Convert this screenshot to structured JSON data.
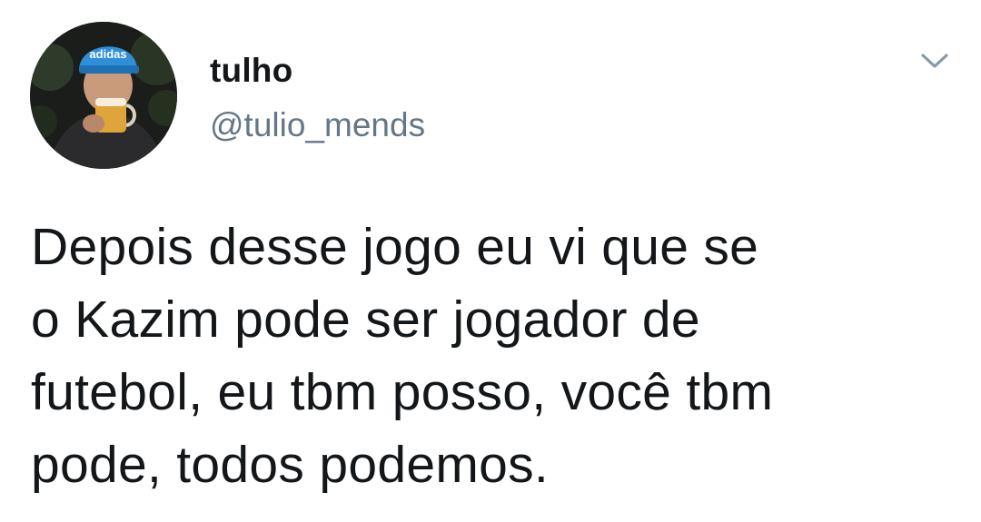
{
  "author": {
    "display_name": "tulho",
    "handle": "@tulio_mends",
    "avatar": {
      "icon": "profile-photo",
      "cap_text": "adidas"
    }
  },
  "menu": {
    "icon": "chevron-down-icon"
  },
  "tweet": {
    "lines": [
      "Depois desse jogo eu vi que se",
      "o Kazim pode ser jogador de",
      "futebol, eu tbm posso, você tbm",
      "pode, todos podemos."
    ]
  },
  "colors": {
    "text": "#14171a",
    "secondary_text": "#657786",
    "chevron": "#8899a6",
    "background": "#ffffff"
  }
}
